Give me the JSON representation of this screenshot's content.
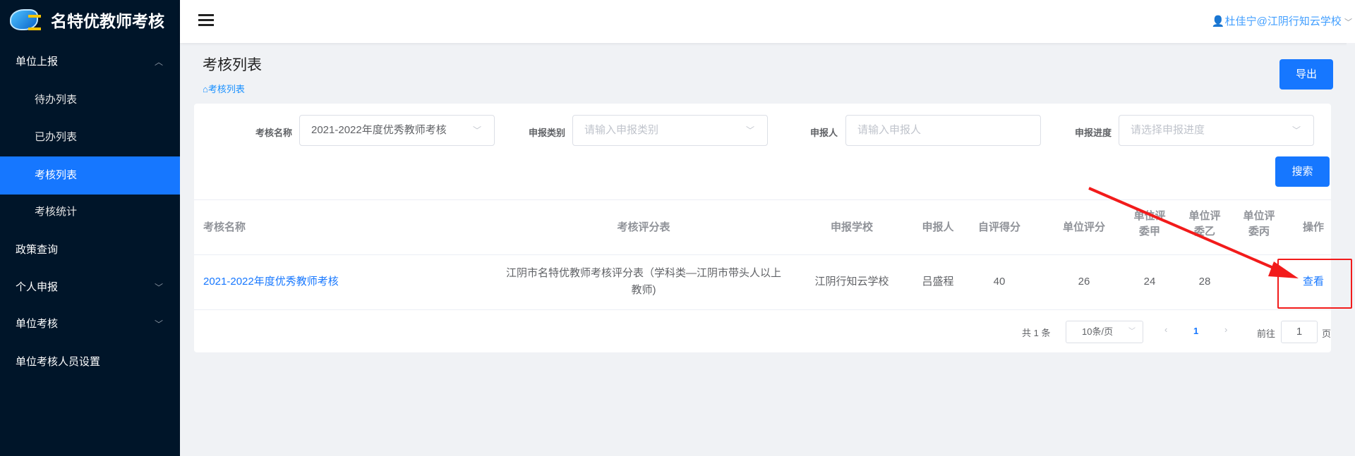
{
  "app": {
    "title": "名特优教师考核",
    "user": "杜佳宁@江阴行知云学校"
  },
  "sidebar": {
    "items": [
      {
        "label": "单位上报",
        "expanded": true
      },
      {
        "label": "待办列表"
      },
      {
        "label": "已办列表"
      },
      {
        "label": "考核列表",
        "active": true
      },
      {
        "label": "考核统计"
      },
      {
        "label": "政策查询"
      },
      {
        "label": "个人申报"
      },
      {
        "label": "单位考核"
      },
      {
        "label": "单位考核人员设置"
      }
    ]
  },
  "page": {
    "title": "考核列表",
    "breadcrumb": "考核列表",
    "export": "导出"
  },
  "filters": {
    "name_label": "考核名称",
    "name_value": "2021-2022年度优秀教师考核",
    "type_label": "申报类别",
    "type_placeholder": "请输入申报类别",
    "person_label": "申报人",
    "person_placeholder": "请输入申报人",
    "progress_label": "申报进度",
    "progress_placeholder": "请选择申报进度",
    "search": "搜索"
  },
  "table": {
    "headers": [
      "考核名称",
      "考核评分表",
      "申报学校",
      "申报人",
      "自评得分",
      "单位评分",
      "单位评委甲",
      "单位评委乙",
      "单位评委丙",
      "操作"
    ],
    "rows": [
      {
        "name": "2021-2022年度优秀教师考核",
        "form": "江阴市名特优教师考核评分表（学科类—江阴市带头人以上教师)",
        "school": "江阴行知云学校",
        "person": "吕盛程",
        "self": "40",
        "unit": "26",
        "a": "24",
        "b": "28",
        "c": "",
        "action": "查看"
      }
    ]
  },
  "pagination": {
    "total": "共 1 条",
    "page_size": "10条/页",
    "current": "1",
    "goto_label": "前往",
    "goto_value": "1",
    "page_suffix": "页"
  },
  "colors": {
    "primary": "#1677ff",
    "sidebar": "#001529",
    "annotation": "#f21b1b"
  }
}
